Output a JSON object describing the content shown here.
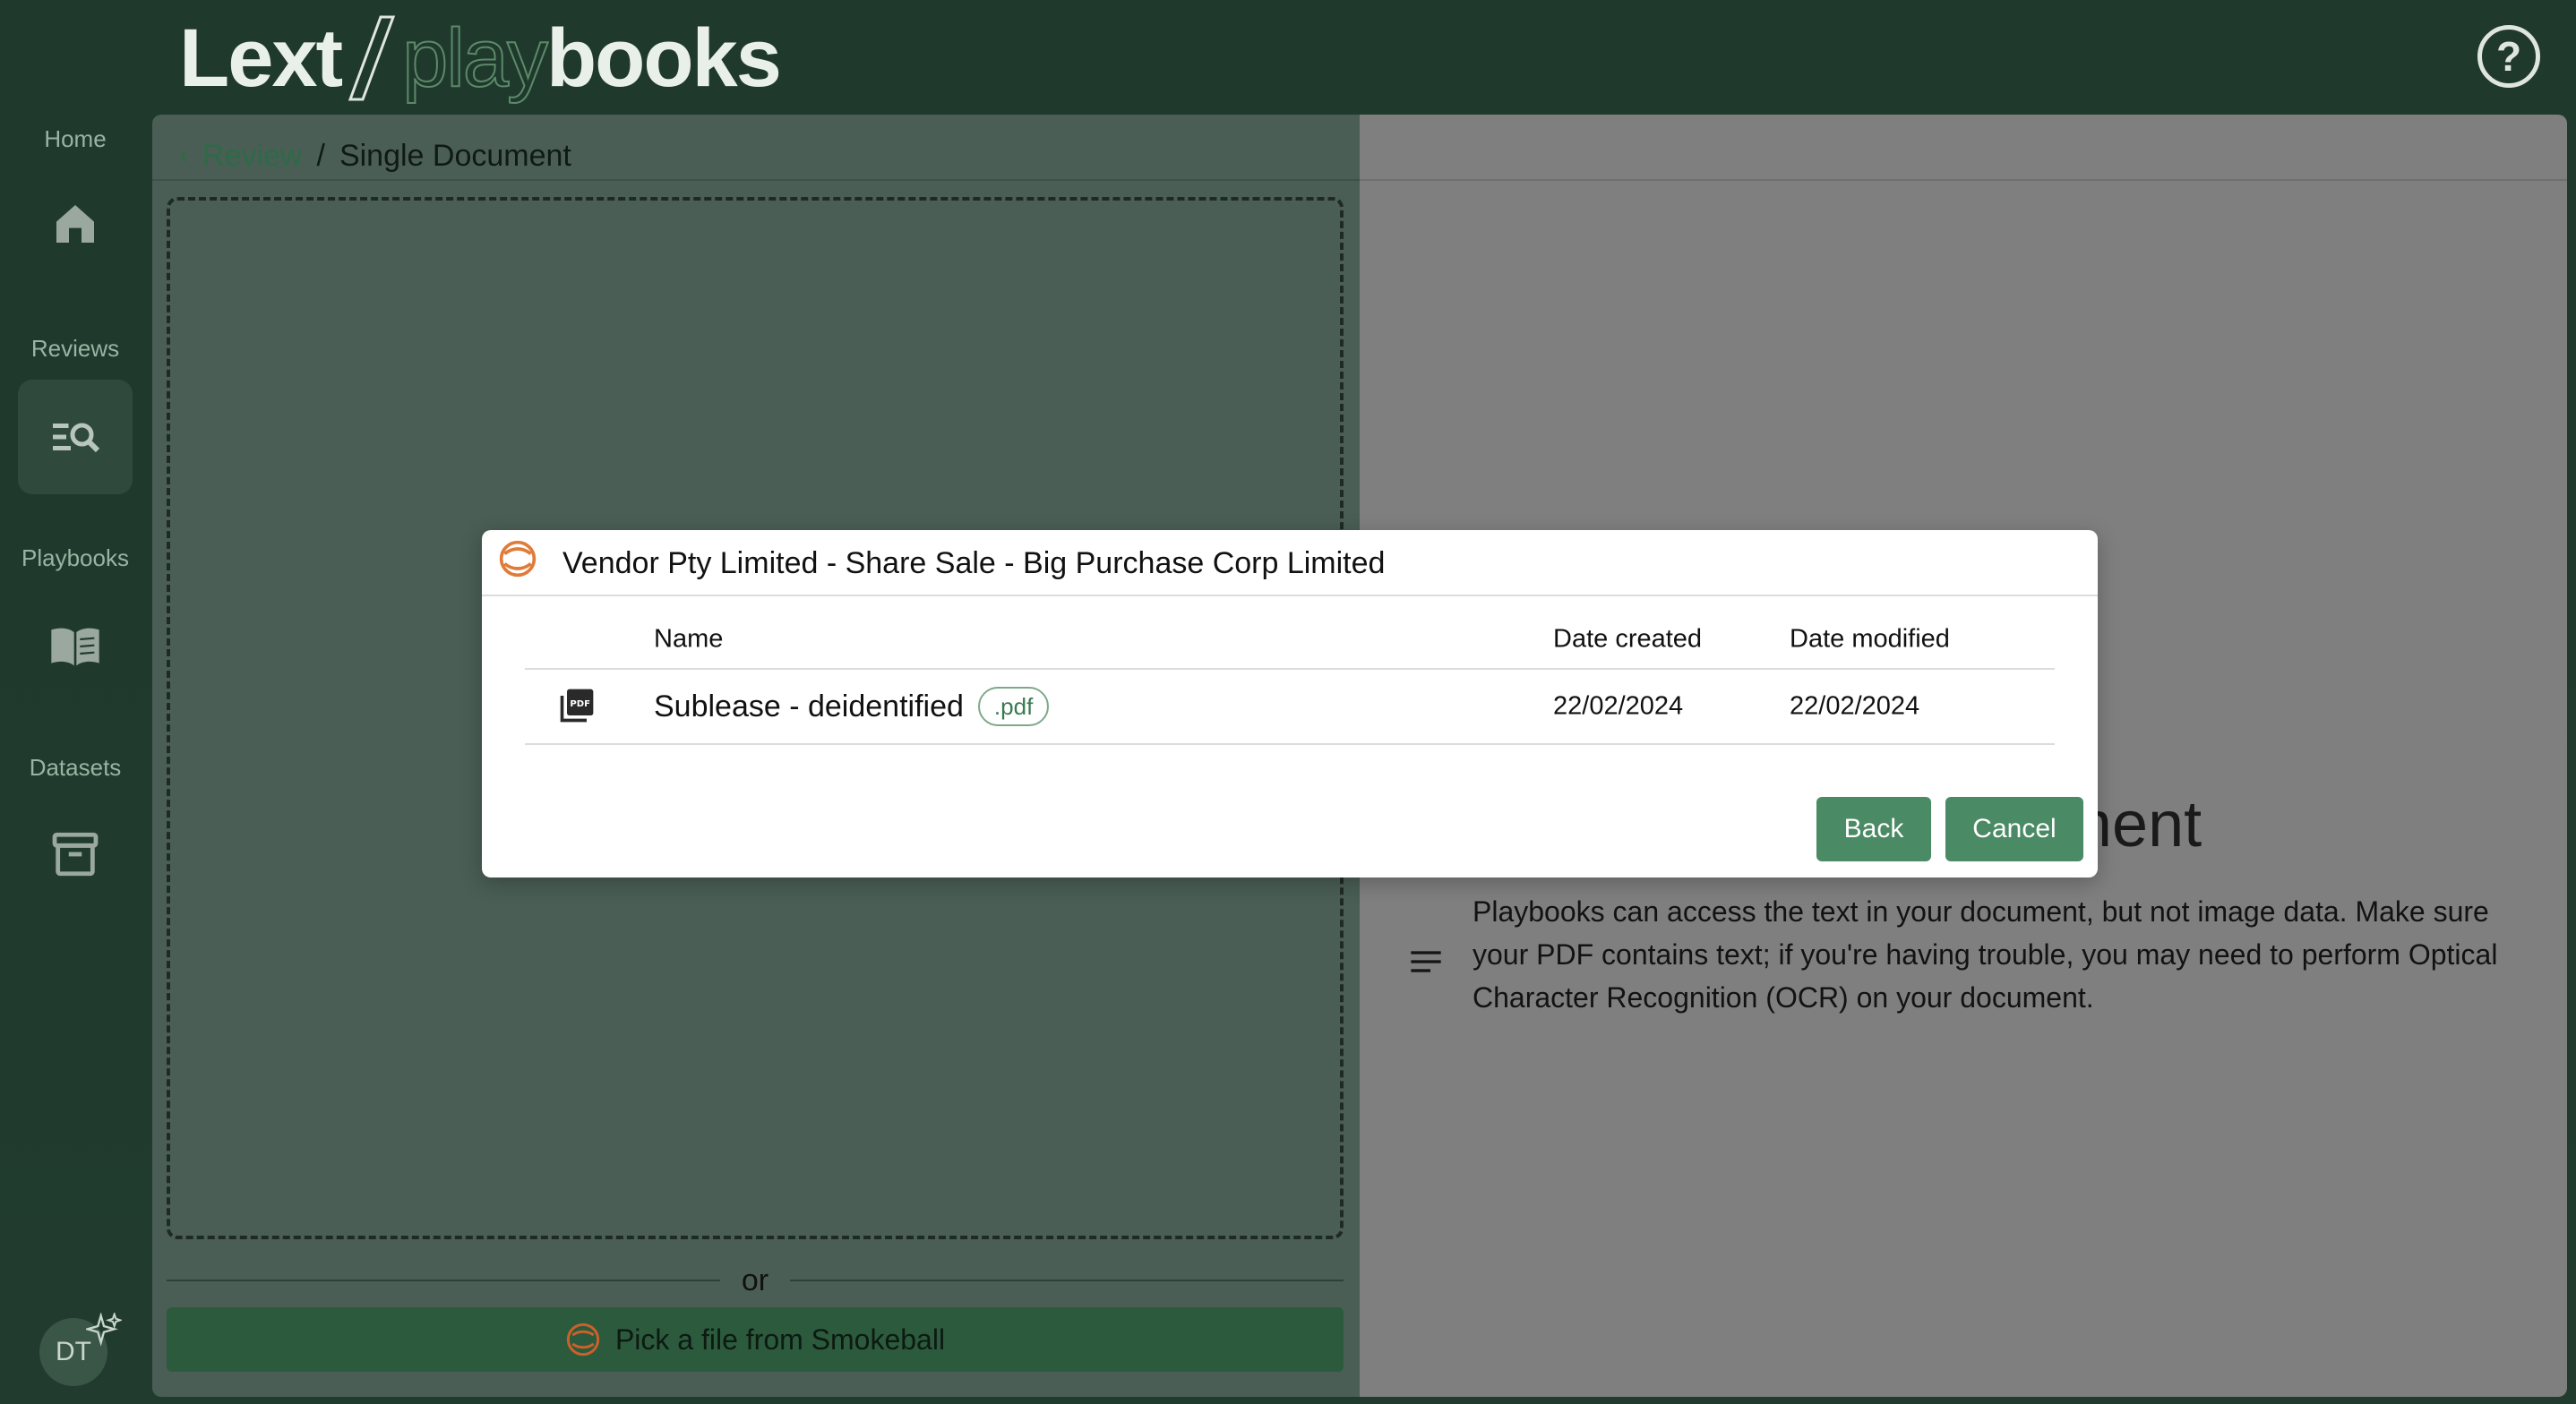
{
  "header": {
    "logo_part1": "Lext",
    "logo_part2": "play",
    "logo_part3": "books",
    "help_symbol": "?"
  },
  "sidebar": {
    "sections": [
      {
        "label": "Home",
        "icon": "home-icon"
      },
      {
        "label": "Reviews",
        "icon": "review-search-icon",
        "active": true
      },
      {
        "label": "Playbooks",
        "icon": "book-icon"
      },
      {
        "label": "Datasets",
        "icon": "archive-icon"
      }
    ],
    "avatar_initials": "DT"
  },
  "breadcrumb": {
    "back_link": "Review",
    "separator": "/",
    "current": "Single Document"
  },
  "upload": {
    "or_text": "or",
    "smokeball_button": "Pick a file from Smokeball"
  },
  "ocr_panel": {
    "heading_fragment": "ument",
    "text": "Playbooks can access the text in your document, but not image data. Make sure your PDF contains text; if you're having trouble, you may need to perform Optical Character Recognition (OCR) on your document."
  },
  "modal": {
    "title": "Vendor Pty Limited - Share Sale - Big Purchase Corp Limited",
    "columns": {
      "name": "Name",
      "created": "Date created",
      "modified": "Date modified"
    },
    "rows": [
      {
        "name": "Sublease - deidentified",
        "extension": ".pdf",
        "created": "22/02/2024",
        "modified": "22/02/2024",
        "icon": "pdf-file-icon"
      }
    ],
    "back_label": "Back",
    "cancel_label": "Cancel"
  },
  "colors": {
    "brand_green": "#4a8a64",
    "header_bg": "#1f3a2d",
    "smokeball_orange": "#e07b39"
  }
}
